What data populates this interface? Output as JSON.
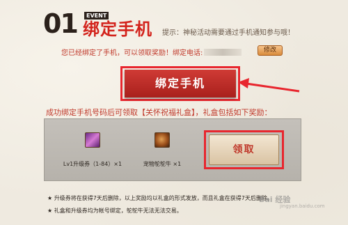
{
  "header": {
    "step_number": "01",
    "event_tag": "EVENT",
    "title": "绑定手机",
    "hint": "提示：神秘活动需要通过手机通知参与哦！"
  },
  "bound_notice": {
    "text": "您已经绑定了手机，可以领取奖励！绑定电话:",
    "modify_label": "修改"
  },
  "bind_button_label": "绑定手机",
  "reward_intro": "成功绑定手机号码后可领取【关怀祝福礼盒】，礼盒包括如下奖励：",
  "rewards": [
    {
      "label": "Lv1升级券（1-84）×1",
      "icon": "level-up-voucher-icon"
    },
    {
      "label": "宠物鸵鸵牛 ×1",
      "icon": "pet-icon"
    }
  ],
  "claim_button_label": "领取",
  "notes": [
    "★ 升级券将在获得7天后删除，以上奖励均以礼盒的形式发放，而且礼盒在获得7天后删除。",
    "★ 礼盒和升级券均为帐号绑定，鸵鸵牛无法无法交易。"
  ],
  "watermark": {
    "text": "Bai 经验",
    "sub": "jingyan.baidu.com"
  },
  "colors": {
    "accent_red": "#d3231c",
    "highlight_red": "#e8262e",
    "button_red": "#b82a24"
  }
}
